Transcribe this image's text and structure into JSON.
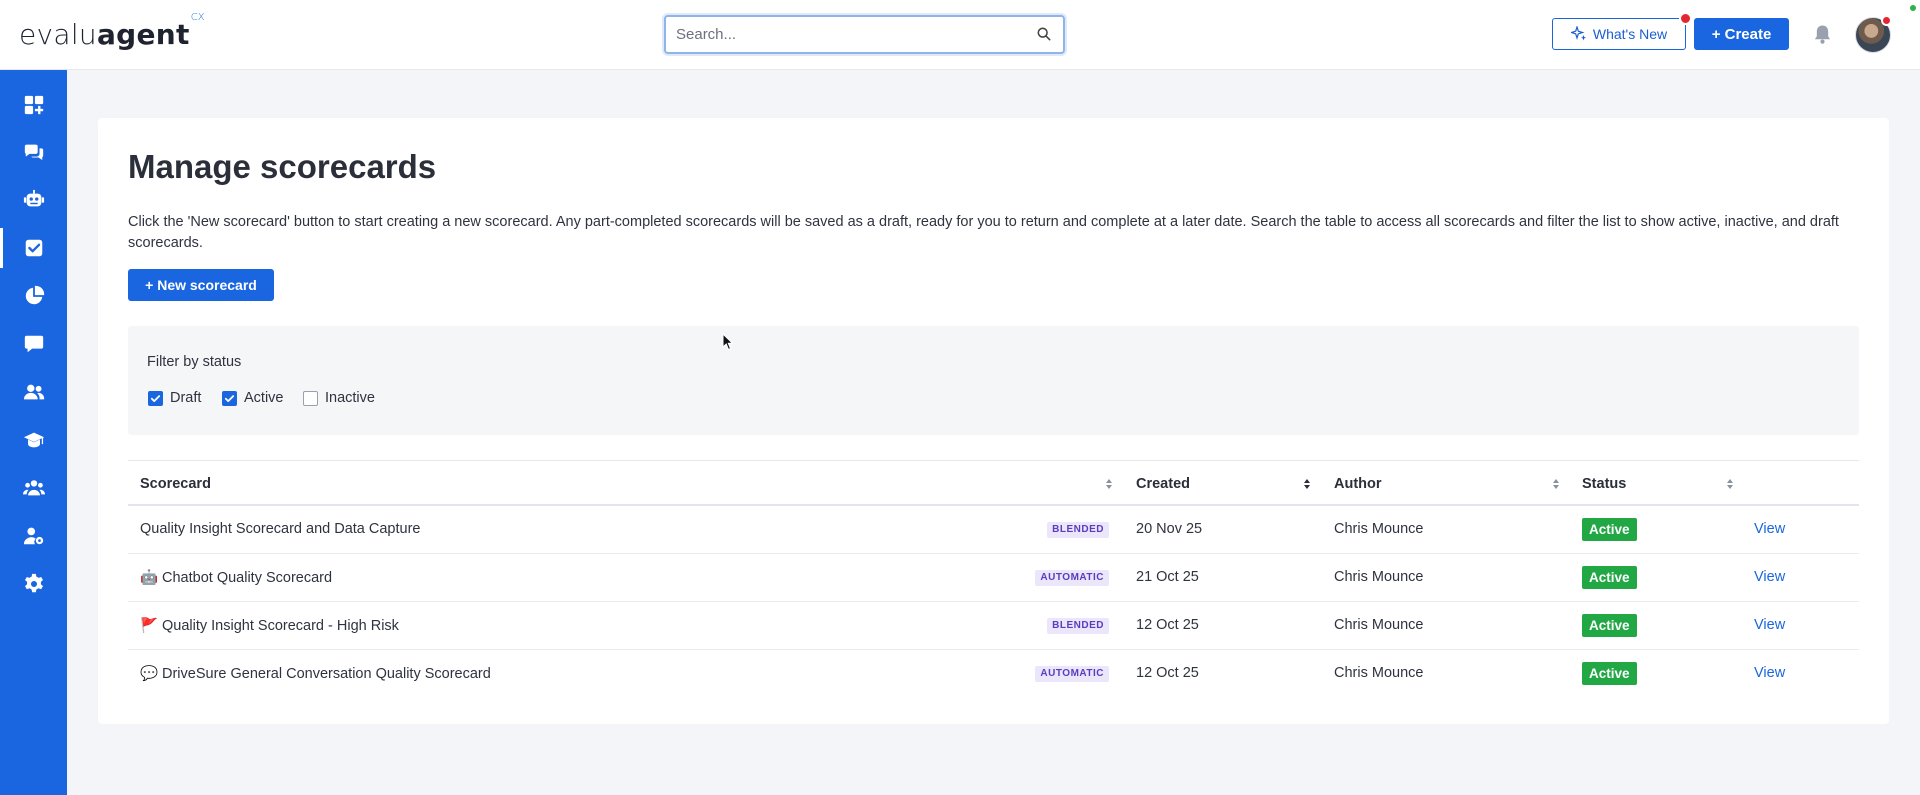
{
  "brand": {
    "name_light": "evalu",
    "name_bold": "agent",
    "suffix": "CX"
  },
  "header": {
    "search_placeholder": "Search...",
    "whats_new_label": "What's New",
    "create_label": "+ Create"
  },
  "sidebar": {
    "items": [
      {
        "icon": "dashboard-add-icon"
      },
      {
        "icon": "chat-bubbles-icon"
      },
      {
        "icon": "robot-icon"
      },
      {
        "icon": "checkbox-icon",
        "active": true
      },
      {
        "icon": "pie-chart-icon"
      },
      {
        "icon": "comment-icon"
      },
      {
        "icon": "users-icon"
      },
      {
        "icon": "graduation-cap-icon"
      },
      {
        "icon": "team-icon"
      },
      {
        "icon": "user-settings-icon"
      },
      {
        "icon": "gear-icon"
      }
    ]
  },
  "page": {
    "title": "Manage scorecards",
    "description": "Click the 'New scorecard' button to start creating a new scorecard. Any part-completed scorecards will be saved as a draft, ready for you to return and complete at a later date. Search the table to access all scorecards and filter the list to show active, inactive, and draft scorecards.",
    "new_button": "+ New scorecard"
  },
  "filter": {
    "label": "Filter by status",
    "options": [
      {
        "label": "Draft",
        "checked": true
      },
      {
        "label": "Active",
        "checked": true
      },
      {
        "label": "Inactive",
        "checked": false
      }
    ]
  },
  "table": {
    "columns": [
      "Scorecard",
      "Created",
      "Author",
      "Status"
    ],
    "rows": [
      {
        "icon": "",
        "name": "Quality Insight Scorecard and Data Capture",
        "tag": "BLENDED",
        "created": "20 Nov 25",
        "author": "Chris Mounce",
        "status": "Active",
        "action": "View"
      },
      {
        "icon": "🤖",
        "name": "Chatbot Quality Scorecard",
        "tag": "AUTOMATIC",
        "created": "21 Oct 25",
        "author": "Chris Mounce",
        "status": "Active",
        "action": "View"
      },
      {
        "icon": "🚩",
        "name": "Quality Insight Scorecard - High Risk",
        "tag": "BLENDED",
        "created": "12 Oct 25",
        "author": "Chris Mounce",
        "status": "Active",
        "action": "View"
      },
      {
        "icon": "💬",
        "name": "DriveSure General Conversation Quality Scorecard",
        "tag": "AUTOMATIC",
        "created": "12 Oct 25",
        "author": "Chris Mounce",
        "status": "Active",
        "action": "View"
      }
    ]
  },
  "colors": {
    "brand_blue": "#1a66e0",
    "status_green": "#22a745",
    "tag_purple": "#5a3cc0",
    "alert_red": "#e3262f"
  }
}
